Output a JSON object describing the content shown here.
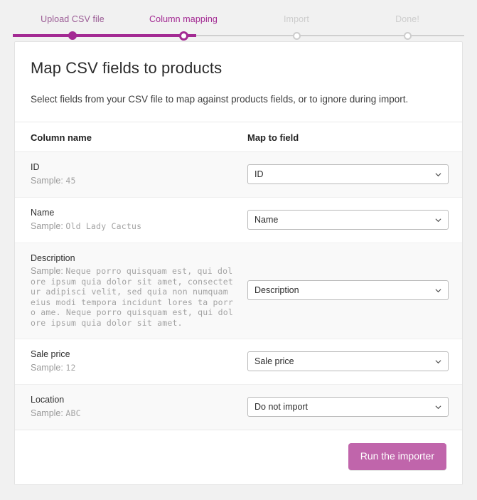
{
  "stepper": {
    "steps": [
      {
        "label": "Upload CSV file",
        "state": "done"
      },
      {
        "label": "Column mapping",
        "state": "current"
      },
      {
        "label": "Import",
        "state": "todo"
      },
      {
        "label": "Done!",
        "state": "todo"
      }
    ],
    "accent_color": "#a32a93",
    "inactive_color": "#cdcdcd"
  },
  "card": {
    "title": "Map CSV fields to products",
    "subtitle": "Select fields from your CSV file to map against products fields, or to ignore during import.",
    "table": {
      "headers": {
        "column_name": "Column name",
        "map_to_field": "Map to field"
      },
      "sample_prefix": "Sample:",
      "rows": [
        {
          "column_name": "ID",
          "sample": "45",
          "selected": "ID"
        },
        {
          "column_name": "Name",
          "sample": "Old Lady Cactus",
          "selected": "Name"
        },
        {
          "column_name": "Description",
          "sample": "Neque porro quisquam est, qui dolore ipsum quia dolor sit amet, consectetur adipisci velit, sed quia non numquam eius modi tempora incidunt lores ta porro ame. Neque porro quisquam est, qui dolore ipsum quia dolor sit amet.",
          "selected": "Description"
        },
        {
          "column_name": "Sale price",
          "sample": "12",
          "selected": "Sale price"
        },
        {
          "column_name": "Location",
          "sample": "ABC",
          "selected": "Do not import"
        }
      ]
    },
    "footer": {
      "run_button": "Run the importer",
      "button_color": "#c065ab"
    }
  }
}
